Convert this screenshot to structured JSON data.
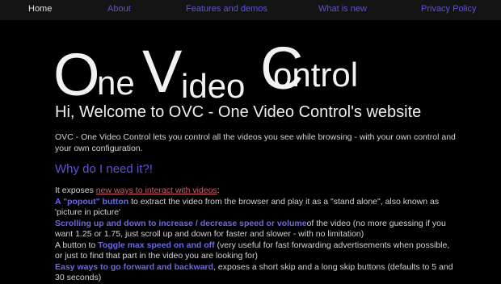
{
  "nav": {
    "home": "Home",
    "about": "About",
    "features": "Features and demos",
    "whatsnew": "What is new",
    "privacy": "Privacy Policy"
  },
  "logo": {
    "o1": "O",
    "ne": "ne",
    "v": "V",
    "ideo": "ideo",
    "c": "C",
    "ontrol": "ontrol"
  },
  "welcome": "Hi, Welcome to OVC - One Video Control's website",
  "intro": "OVC - One Video Control lets you control all the videos you see while browsing - with your own control and your own configuration.",
  "why_heading": "Why do I need it?!",
  "content": {
    "exposes_prefix": "It exposes ",
    "exposes_link": "new ways to interact with videos",
    "exposes_suffix": ":",
    "popout_hl": "A \"popout\" button",
    "popout_text": " to extract the video from the browser and play it as a \"stand alone\", also known as 'picture in picture'",
    "scroll_hl": "Scrolling up and down to increase / decrease speed or volume",
    "scroll_text": "of the video (no more guessing if you want 1.25 or 1.75, just scroll up and down for faster and slower - with no limitation)",
    "toggle_prefix": "A button to ",
    "toggle_hl": "Toggle max speed on and off",
    "toggle_text": " (very useful for fast forwarding advertisements when possible, or just to find that part in the video you are looking for)",
    "skip_hl": "Easy ways to go forward and backward",
    "skip_text": ", exposes a short skip and a long skip buttons (defaults to 5 and 30 seconds)"
  },
  "colors": {
    "background": "#000000",
    "nav_bg": "#141414",
    "link": "#5a55d6",
    "highlight": "#6a6ae0",
    "inline_link": "#d05a70"
  }
}
